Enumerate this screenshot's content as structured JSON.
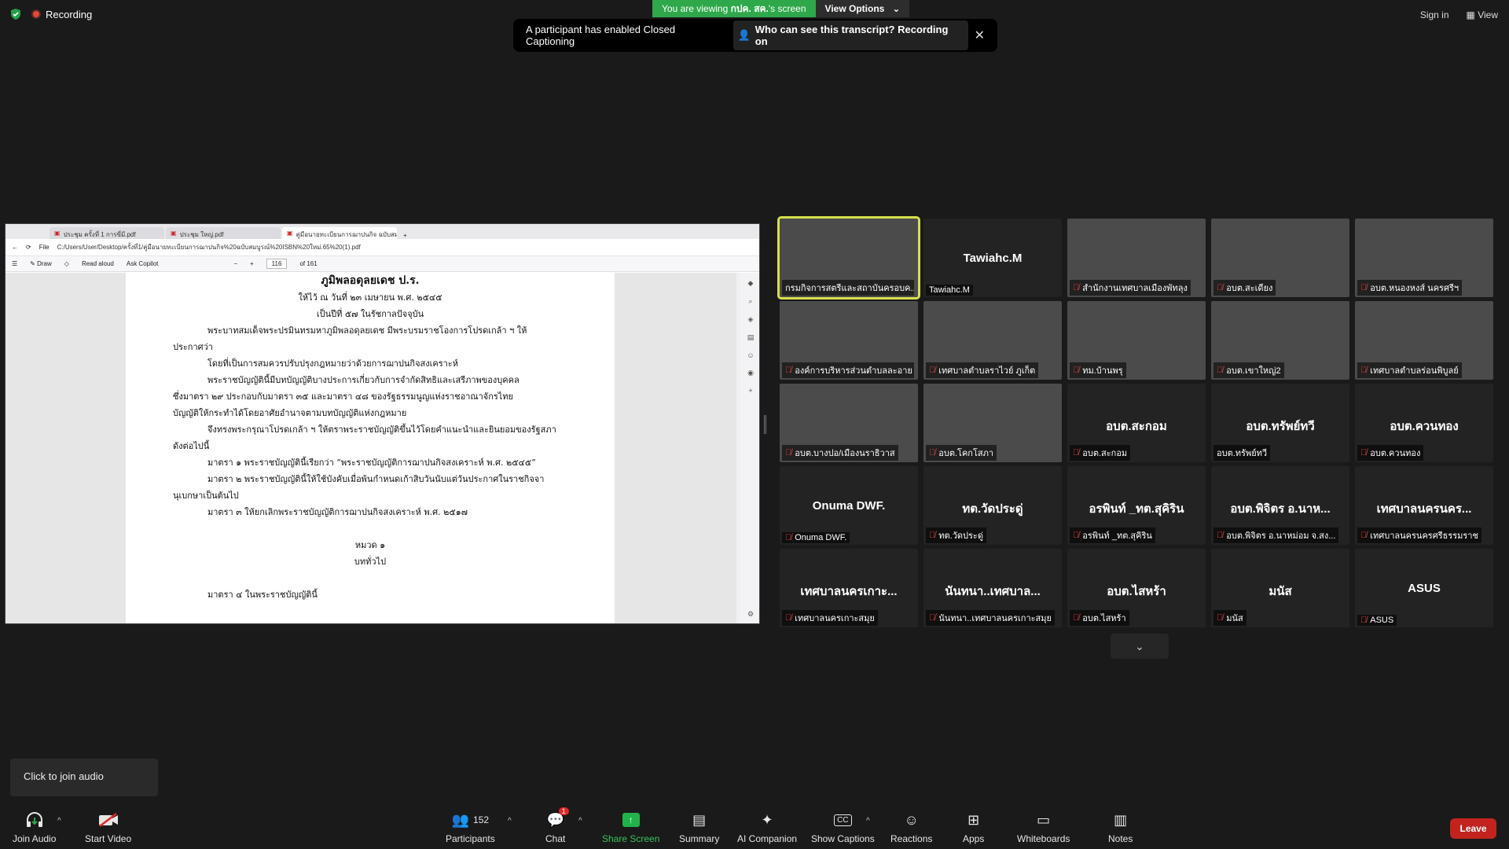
{
  "top": {
    "recording_label": "Recording",
    "viewing_prefix": "You are viewing ",
    "viewing_name": "กปค. สค.",
    "viewing_suffix": "'s screen",
    "view_options": "View Options",
    "cc_message": "A participant has enabled Closed Captioning",
    "cc_link": "Who can see this transcript? Recording on",
    "sign_in": "Sign in",
    "view": "View"
  },
  "shared_screen": {
    "tabs": [
      "ประชุม ครั้งที่ 1 การขี่มี.pdf",
      "ประชุม ใหญ่.pdf",
      "คู่มือนายทะเบียนการฌาปนกิจ ฉบับสมบูรณ์"
    ],
    "file_label": "File",
    "url": "C:/Users/User/Desktop/ครั้งที่1/คู่มือนายทะเบียนการฌาปนกิจ%20ฉบับสมบูรณ์%20ISBN%20ใหม่.65%20(1).pdf",
    "draw": "Draw",
    "read_aloud": "Read aloud",
    "ask_copilot": "Ask Copilot",
    "page_current": "116",
    "page_total": "of 161",
    "doc_lines": [
      {
        "text": "ภูมิพลอดุลยเดช ป.ร.",
        "style": "title"
      },
      {
        "text": "ให้ไว้ ณ วันที่ ๒๓ เมษายน พ.ศ. ๒๕๔๕",
        "style": "center"
      },
      {
        "text": "เป็นปีที่ ๕๗ ในรัชกาลปัจจุบัน",
        "style": "center"
      },
      {
        "text": "พระบาทสมเด็จพระปรมินทรมหาภูมิพลอดุลยเดช  มีพระบรมราชโองการโปรดเกล้า ฯ  ให้",
        "style": "indent"
      },
      {
        "text": "ประกาศว่า",
        "style": "plain"
      },
      {
        "text": "โดยที่เป็นการสมควรปรับปรุงกฎหมายว่าด้วยการฌาปนกิจสงเคราะห์",
        "style": "indent"
      },
      {
        "text": "พระราชบัญญัตินี้มีบทบัญญัติบางประการเกี่ยวกับการจำกัดสิทธิและเสรีภาพของบุคคล",
        "style": "indent"
      },
      {
        "text": "ซึ่งมาตรา  ๒๙  ประกอบกับมาตรา  ๓๕  และมาตรา  ๔๘  ของรัฐธรรมนูญแห่งราชอาณาจักรไทย",
        "style": "plain"
      },
      {
        "text": "บัญญัติให้กระทำได้โดยอาศัยอำนาจตามบทบัญญัติแห่งกฎหมาย",
        "style": "plain"
      },
      {
        "text": "จึงทรงพระกรุณาโปรดเกล้า ฯ  ให้ตราพระราชบัญญัติขึ้นไว้โดยคำแนะนำและยินยอมของรัฐสภา",
        "style": "indent"
      },
      {
        "text": "ดังต่อไปนี้",
        "style": "plain"
      },
      {
        "text": "มาตรา  ๑  พระราชบัญญัตินี้เรียกว่า “พระราชบัญญัติการฌาปนกิจสงเคราะห์  พ.ศ. ๒๕๔๕”",
        "style": "indent"
      },
      {
        "text": "มาตรา  ๒  พระราชบัญญัตินี้ให้ใช้บังคับเมื่อพ้นกำหนดเก้าสิบวันนับแต่วันประกาศในราชกิจจา",
        "style": "indent"
      },
      {
        "text": "นุเบกษาเป็นต้นไป",
        "style": "plain"
      },
      {
        "text": "มาตรา  ๓  ให้ยกเลิกพระราชบัญญัติการฌาปนกิจสงเคราะห์ พ.ศ. ๒๕๑๗",
        "style": "indent"
      },
      {
        "text": "",
        "style": "plain"
      },
      {
        "text": "หมวด ๑",
        "style": "center"
      },
      {
        "text": "บททั่วไป",
        "style": "center"
      },
      {
        "text": "",
        "style": "plain"
      },
      {
        "text": "มาตรา  ๔  ในพระราชบัญญัตินี้",
        "style": "indent"
      }
    ]
  },
  "participants": [
    {
      "display": "",
      "tag": "กรมกิจการสตรีและสถาบันครอบค...",
      "video": "v1",
      "muted": false,
      "active": true
    },
    {
      "display": "Tawiahc.M",
      "tag": "Tawiahc.M",
      "video": "",
      "muted": false,
      "active": false
    },
    {
      "display": "",
      "tag": "สำนักงานเทศบาลเมืองพัทลุง",
      "video": "v2",
      "muted": true,
      "active": false
    },
    {
      "display": "",
      "tag": "อบต.สะเดียง",
      "video": "v3",
      "muted": true,
      "active": false
    },
    {
      "display": "",
      "tag": "อบต.หนองหงส์ นครศรีฯ",
      "video": "v4",
      "muted": true,
      "active": false
    },
    {
      "display": "",
      "tag": "องค์การบริหารส่วนตำบลละอาย",
      "video": "v5",
      "muted": true,
      "active": false
    },
    {
      "display": "",
      "tag": "เทศบาลตำบลราไวย์ ภูเก็ต",
      "video": "v6",
      "muted": true,
      "active": false
    },
    {
      "display": "",
      "tag": "ทม.บ้านพรุ",
      "video": "v7",
      "muted": true,
      "active": false
    },
    {
      "display": "",
      "tag": "อบต.เขาใหญ่2",
      "video": "v8",
      "muted": true,
      "active": false
    },
    {
      "display": "",
      "tag": "เทศบาลตำบลร่อนพิบูลย์",
      "video": "v9",
      "muted": true,
      "active": false
    },
    {
      "display": "",
      "tag": "อบต.บางปอ/เมืองนราธิวาส",
      "video": "v10",
      "muted": true,
      "active": false
    },
    {
      "display": "",
      "tag": "อบต.โคกโสภา",
      "video": "v11",
      "muted": true,
      "active": false
    },
    {
      "display": "อบต.สะกอม",
      "tag": "อบต.สะกอม",
      "video": "",
      "muted": true,
      "active": false
    },
    {
      "display": "อบต.ทรัพย์ทวี",
      "tag": "อบต.ทรัพย์ทวี",
      "video": "",
      "muted": false,
      "active": false
    },
    {
      "display": "อบต.ควนทอง",
      "tag": "อบต.ควนทอง",
      "video": "",
      "muted": true,
      "active": false
    },
    {
      "display": "Onuma DWF.",
      "tag": "Onuma DWF.",
      "video": "",
      "muted": true,
      "active": false
    },
    {
      "display": "ทต.วัดประดู่",
      "tag": "ทต.วัดประดู่",
      "video": "",
      "muted": true,
      "active": false
    },
    {
      "display": "อรพินท์ _ทต.สุคิริน",
      "tag": "อรพินท์ _ทต.สุคิริน",
      "video": "",
      "muted": true,
      "active": false
    },
    {
      "display": "อบต.พิจิตร อ.นาห...",
      "tag": "อบต.พิจิตร อ.นาหม่อม จ.สง...",
      "video": "",
      "muted": true,
      "active": false
    },
    {
      "display": "เทศบาลนครนคร...",
      "tag": "เทศบาลนครนครศรีธรรมราช",
      "video": "",
      "muted": true,
      "active": false
    },
    {
      "display": "เทศบาลนครเกาะ...",
      "tag": "เทศบาลนครเกาะสมุย",
      "video": "",
      "muted": true,
      "active": false
    },
    {
      "display": "นันทนา..เทศบาล...",
      "tag": "นันทนา..เทศบาลนครเกาะสมุย",
      "video": "",
      "muted": true,
      "active": false
    },
    {
      "display": "อบต.ไสหร้า",
      "tag": "อบต.ไสหร้า",
      "video": "",
      "muted": true,
      "active": false
    },
    {
      "display": "มนัส",
      "tag": "มนัส",
      "video": "",
      "muted": true,
      "active": false
    },
    {
      "display": "ASUS",
      "tag": "ASUS",
      "video": "",
      "muted": true,
      "active": false
    }
  ],
  "tooltip": "Click to join audio",
  "toolbar": {
    "join_audio": "Join Audio",
    "start_video": "Start Video",
    "participants": "Participants",
    "participants_count": "152",
    "chat": "Chat",
    "chat_badge": "1",
    "share_screen": "Share Screen",
    "summary": "Summary",
    "ai_companion": "AI Companion",
    "show_captions": "Show Captions",
    "reactions": "Reactions",
    "apps": "Apps",
    "whiteboards": "Whiteboards",
    "notes": "Notes",
    "leave": "Leave"
  },
  "colors": {
    "share_green": "#2ea84a",
    "leave_red": "#c2231f",
    "active_speaker": "#d6e04b",
    "muted_red": "#e84040"
  }
}
